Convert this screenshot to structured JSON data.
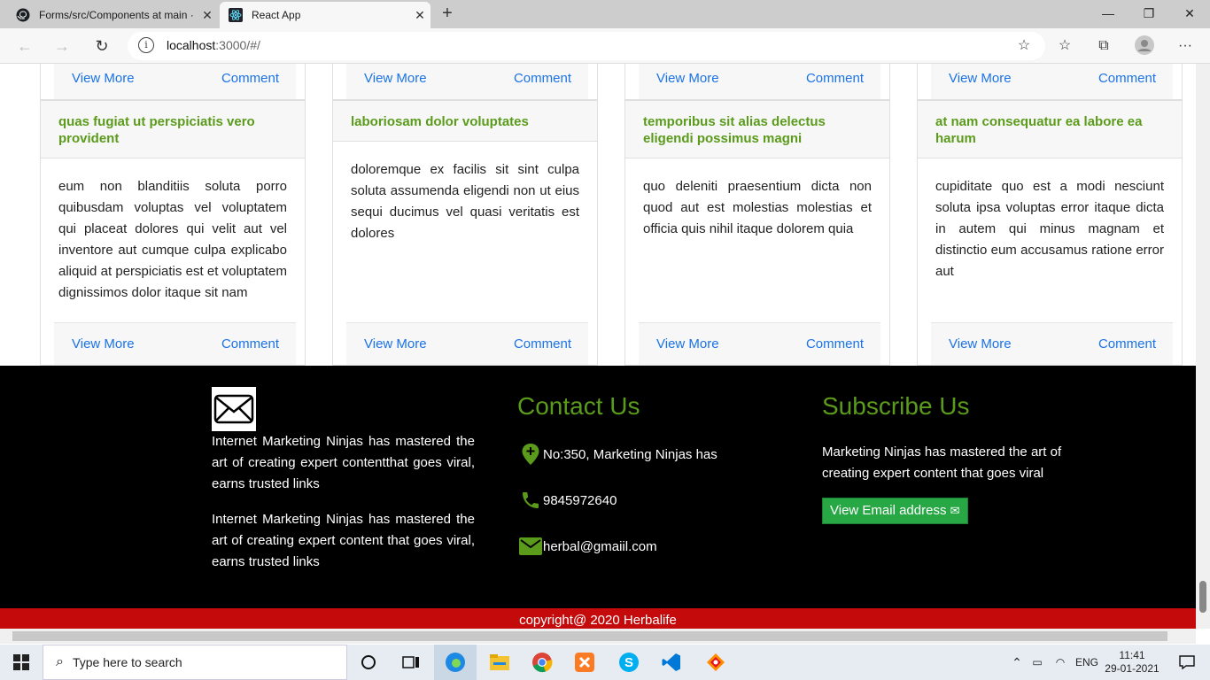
{
  "browser": {
    "tabs": [
      {
        "title": "Forms/src/Components at main ·",
        "icon": "github-icon"
      },
      {
        "title": "React App",
        "icon": "react-icon"
      }
    ],
    "url_host": "localhost",
    "url_rest": ":3000/#/"
  },
  "cards_top_row": [
    {
      "view_more": "View More",
      "comment": "Comment"
    },
    {
      "view_more": "View More",
      "comment": "Comment"
    },
    {
      "view_more": "View More",
      "comment": "Comment"
    },
    {
      "view_more": "View More",
      "comment": "Comment"
    }
  ],
  "cards": [
    {
      "title": "quas fugiat ut perspiciatis vero provident",
      "body": "eum non blanditiis soluta porro quibusdam voluptas vel voluptatem qui placeat dolores qui velit aut vel inventore aut cumque culpa explicabo aliquid at perspiciatis est et voluptatem dignissimos dolor itaque sit nam",
      "view_more": "View More",
      "comment": "Comment"
    },
    {
      "title": "laboriosam dolor voluptates",
      "body": "doloremque ex facilis sit sint culpa soluta assumenda eligendi non ut eius sequi ducimus vel quasi veritatis est dolores",
      "view_more": "View More",
      "comment": "Comment"
    },
    {
      "title": "temporibus sit alias delectus eligendi possimus magni",
      "body": "quo deleniti praesentium dicta non quod aut est molestias molestias et officia quis nihil itaque dolorem quia",
      "view_more": "View More",
      "comment": "Comment"
    },
    {
      "title": "at nam consequatur ea labore ea harum",
      "body": "cupiditate quo est a modi nesciunt soluta ipsa voluptas error itaque dicta in autem qui minus magnam et distinctio eum accusamus ratione error aut",
      "view_more": "View More",
      "comment": "Comment"
    }
  ],
  "footer": {
    "about_p1": "Internet Marketing Ninjas has mastered the art of creating expert contentthat goes viral, earns trusted links",
    "about_p2": "Internet Marketing Ninjas has mastered the art of creating expert content that goes viral, earns trusted links",
    "contact_heading": "Contact Us",
    "address": "No:350, Marketing Ninjas has",
    "phone": "9845972640",
    "email": "herbal@gmaiil.com",
    "subscribe_heading": "Subscribe Us",
    "subscribe_text": "Marketing Ninjas has mastered the art of creating expert content that goes viral",
    "subscribe_button": "View Email address",
    "copyright": "copyright@ 2020 Herbalife",
    "accent_color": "#5b9b1c"
  },
  "taskbar": {
    "search_placeholder": "Type here to search",
    "language": "ENG",
    "time": "11:41",
    "date": "29-01-2021"
  }
}
